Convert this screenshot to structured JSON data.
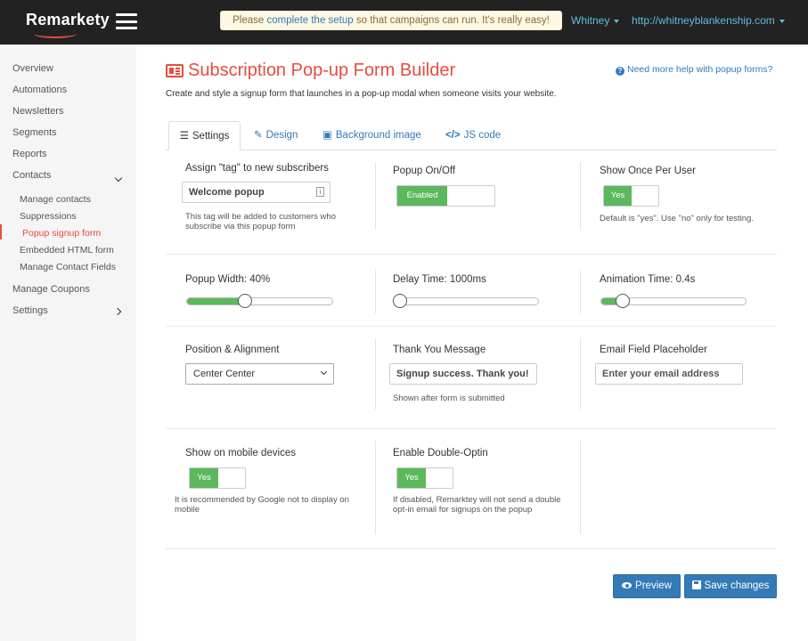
{
  "app": {
    "logo": "Remarkety",
    "notice": {
      "before": "Please ",
      "link": "complete the setup",
      "after": " so that campaigns can run. It's really easy!"
    },
    "user": "Whitney",
    "site": "http://whitneyblankenship.com"
  },
  "sidebar": {
    "overview": "Overview",
    "automations": "Automations",
    "newsletters": "Newsletters",
    "segments": "Segments",
    "reports": "Reports",
    "contacts": "Contacts",
    "manage_contacts": "Manage contacts",
    "suppressions": "Suppressions",
    "popup_signup": "Popup signup form",
    "embedded_html": "Embedded HTML form",
    "manage_fields": "Manage Contact Fields",
    "manage_coupons": "Manage Coupons",
    "settings": "Settings"
  },
  "header": {
    "title": "Subscription Pop-up Form Builder",
    "subtitle": "Create and style a signup form that launches in a pop-up modal when someone visits your website.",
    "help": "Need more help with popup forms?"
  },
  "tabs": {
    "settings": "Settings",
    "design": "Design",
    "background": "Background image",
    "js": "JS code"
  },
  "form": {
    "tag_label": "Assign \"tag\" to new subscribers",
    "tag_value": "Welcome popup",
    "tag_help": "This tag will be added to customers who subscribe via this popup form",
    "popup_label": "Popup On/Off",
    "popup_state": "Enabled",
    "once_label": "Show Once Per User",
    "once_state": "Yes",
    "once_help": "Default is \"yes\". Use \"no\" only for testing.",
    "width_label": "Popup Width: 40%",
    "width_value": 40,
    "delay_label": "Delay Time: 1000ms",
    "delay_value": 0,
    "anim_label": "Animation Time: 0.4s",
    "anim_value": 15,
    "position_label": "Position & Alignment",
    "position_value": "Center Center",
    "thanks_label": "Thank You Message",
    "thanks_value": "Signup success. Thank you!",
    "thanks_help": "Shown after form is submitted",
    "email_label": "Email Field Placeholder",
    "email_placeholder": "Enter your email address",
    "mobile_label": "Show on mobile devices",
    "mobile_state": "Yes",
    "mobile_help": "It is recommended by Google not to display on mobile",
    "double_label": "Enable Double-Optin",
    "double_state": "Yes",
    "double_help": "If disabled, Remarktey will not send a double opt-in email for signups on the popup"
  },
  "actions": {
    "preview": "Preview",
    "save": "Save changes"
  }
}
